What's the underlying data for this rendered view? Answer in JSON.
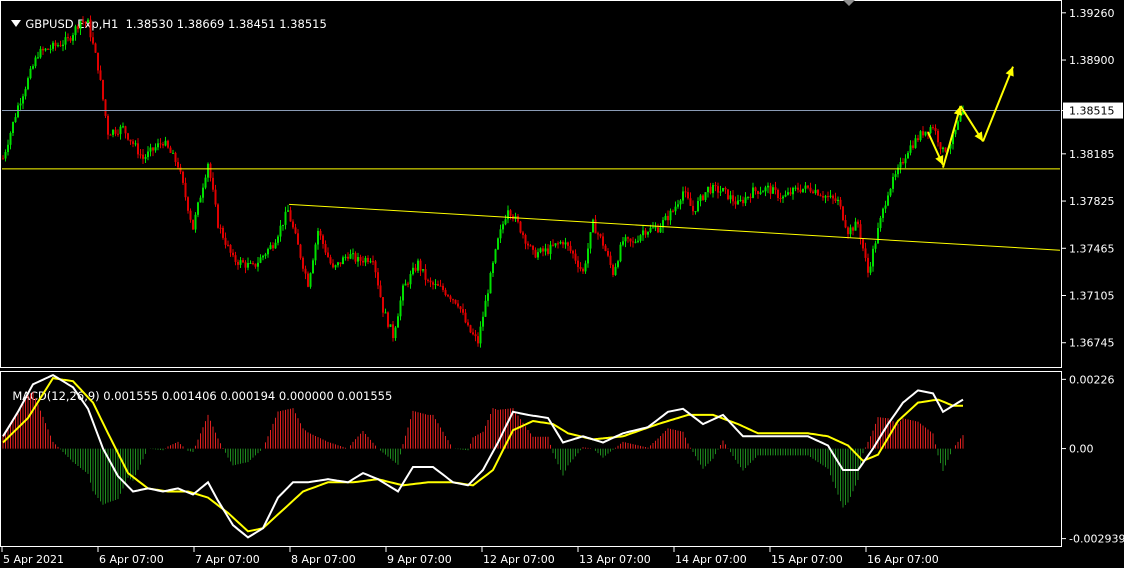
{
  "header": {
    "symbol_line": "GBPUSD.Exp,H1  1.38530 1.38669 1.38451 1.38515",
    "menu_icon": "triangle-down-icon"
  },
  "macd_header": "MACD(12,26,9) 0.001555 0.001406 0.000194 0.000000 0.001555",
  "colors": {
    "background": "#000000",
    "bull": "#00e000",
    "bear": "#e00000",
    "grid_frame": "#ffffff",
    "support_line": "#ffff00",
    "current_price_line": "#8a9bb5",
    "arrows": "#ffff00",
    "macd_line": "#ffffff",
    "signal_line": "#ffff00",
    "hist_pos": "#e02020",
    "hist_neg": "#1e8a1e"
  },
  "chart_data": [
    {
      "type": "candlestick",
      "symbol": "GBPUSD.Exp",
      "timeframe": "H1",
      "ohlc_current": {
        "open": 1.3853,
        "high": 1.38669,
        "low": 1.38451,
        "close": 1.38515
      },
      "ylim": [
        1.3656,
        1.3935
      ],
      "y_ticks": [
        "1.39260",
        "1.38900",
        "1.38515",
        "1.38185",
        "1.37825",
        "1.37465",
        "1.37105",
        "1.36745"
      ],
      "current_price": 1.38515,
      "current_price_label": "1.38515",
      "horizontal_level": 1.3807,
      "trendline": {
        "from": [
          0.2713,
          1.378
        ],
        "to": [
          1.0,
          1.3745
        ]
      },
      "x_ticks": [
        "5 Apr 2021",
        "6 Apr 07:00",
        "7 Apr 07:00",
        "8 Apr 07:00",
        "9 Apr 07:00",
        "12 Apr 07:00",
        "13 Apr 07:00",
        "14 Apr 07:00",
        "15 Apr 07:00",
        "16 Apr 07:00"
      ],
      "path_keypoints": [
        [
          0,
          1.3815
        ],
        [
          6,
          1.3855
        ],
        [
          14,
          1.3895
        ],
        [
          26,
          1.3905
        ],
        [
          31,
          1.392
        ],
        [
          34,
          1.3918
        ],
        [
          38,
          1.3885
        ],
        [
          42,
          1.3835
        ],
        [
          48,
          1.3838
        ],
        [
          56,
          1.3815
        ],
        [
          64,
          1.3828
        ],
        [
          70,
          1.381
        ],
        [
          76,
          1.3762
        ],
        [
          82,
          1.3812
        ],
        [
          86,
          1.3765
        ],
        [
          92,
          1.3738
        ],
        [
          100,
          1.3732
        ],
        [
          108,
          1.375
        ],
        [
          114,
          1.3775
        ],
        [
          118,
          1.3748
        ],
        [
          122,
          1.372
        ],
        [
          126,
          1.376
        ],
        [
          132,
          1.373
        ],
        [
          138,
          1.3742
        ],
        [
          142,
          1.3737
        ],
        [
          148,
          1.374
        ],
        [
          152,
          1.37
        ],
        [
          156,
          1.368
        ],
        [
          160,
          1.3715
        ],
        [
          166,
          1.3735
        ],
        [
          170,
          1.372
        ],
        [
          176,
          1.3715
        ],
        [
          182,
          1.3705
        ],
        [
          186,
          1.3685
        ],
        [
          190,
          1.3675
        ],
        [
          194,
          1.3715
        ],
        [
          198,
          1.3752
        ],
        [
          202,
          1.3778
        ],
        [
          206,
          1.3765
        ],
        [
          212,
          1.3742
        ],
        [
          218,
          1.3745
        ],
        [
          224,
          1.3752
        ],
        [
          228,
          1.3742
        ],
        [
          232,
          1.3728
        ],
        [
          236,
          1.3765
        ],
        [
          240,
          1.375
        ],
        [
          244,
          1.3728
        ],
        [
          248,
          1.3752
        ],
        [
          252,
          1.375
        ],
        [
          256,
          1.376
        ],
        [
          262,
          1.3762
        ],
        [
          268,
          1.3775
        ],
        [
          272,
          1.379
        ],
        [
          276,
          1.3775
        ],
        [
          282,
          1.3792
        ],
        [
          288,
          1.379
        ],
        [
          294,
          1.378
        ],
        [
          300,
          1.379
        ],
        [
          306,
          1.3792
        ],
        [
          312,
          1.3785
        ],
        [
          318,
          1.3792
        ],
        [
          324,
          1.3792
        ],
        [
          330,
          1.3785
        ],
        [
          334,
          1.3782
        ],
        [
          338,
          1.376
        ],
        [
          342,
          1.3765
        ],
        [
          346,
          1.3728
        ],
        [
          350,
          1.376
        ],
        [
          354,
          1.379
        ],
        [
          358,
          1.3805
        ],
        [
          362,
          1.3822
        ],
        [
          368,
          1.3835
        ],
        [
          372,
          1.384
        ],
        [
          376,
          1.382
        ],
        [
          380,
          1.383
        ],
        [
          384,
          1.3852
        ]
      ],
      "annotation_arrows": [
        {
          "from": [
            370,
            1.3835
          ],
          "to": [
            376,
            1.381
          ]
        },
        {
          "from": [
            376,
            1.3808
          ],
          "to": [
            383,
            1.3855
          ]
        },
        {
          "from": [
            383,
            1.3855
          ],
          "to": [
            392,
            1.3828
          ]
        },
        {
          "from": [
            392,
            1.3828
          ],
          "to": [
            404,
            1.3885
          ]
        }
      ]
    },
    {
      "type": "macd",
      "params": "12,26,9",
      "values": {
        "macd": 0.001555,
        "signal": 0.001406,
        "histogram": 0.000194,
        "extra": 0.0,
        "main": 0.001555
      },
      "ylim": [
        -0.00318,
        0.0025
      ],
      "y_ticks": [
        "0.00226",
        "0.00",
        "-0.002939"
      ],
      "macd_keypoints": [
        [
          0,
          0.0004
        ],
        [
          6,
          0.0012
        ],
        [
          12,
          0.0021
        ],
        [
          20,
          0.0024
        ],
        [
          28,
          0.002
        ],
        [
          34,
          0.0013
        ],
        [
          40,
          0.0
        ],
        [
          46,
          -0.0009
        ],
        [
          52,
          -0.0014
        ],
        [
          58,
          -0.0013
        ],
        [
          64,
          -0.0014
        ],
        [
          70,
          -0.0013
        ],
        [
          76,
          -0.0015
        ],
        [
          82,
          -0.0011
        ],
        [
          86,
          -0.0017
        ],
        [
          92,
          -0.0025
        ],
        [
          98,
          -0.0029
        ],
        [
          104,
          -0.0026
        ],
        [
          110,
          -0.0016
        ],
        [
          116,
          -0.0011
        ],
        [
          122,
          -0.0011
        ],
        [
          130,
          -0.001
        ],
        [
          138,
          -0.0011
        ],
        [
          144,
          -0.0008
        ],
        [
          150,
          -0.001
        ],
        [
          158,
          -0.0014
        ],
        [
          164,
          -0.0006
        ],
        [
          172,
          -0.0006
        ],
        [
          180,
          -0.0011
        ],
        [
          186,
          -0.0012
        ],
        [
          192,
          -0.0007
        ],
        [
          198,
          0.0002
        ],
        [
          204,
          0.0012
        ],
        [
          210,
          0.0011
        ],
        [
          218,
          0.001
        ],
        [
          224,
          0.0002
        ],
        [
          232,
          0.0004
        ],
        [
          240,
          0.0002
        ],
        [
          248,
          0.0005
        ],
        [
          258,
          0.0007
        ],
        [
          266,
          0.0012
        ],
        [
          272,
          0.0013
        ],
        [
          280,
          0.0008
        ],
        [
          288,
          0.0011
        ],
        [
          296,
          0.0004
        ],
        [
          304,
          0.0004
        ],
        [
          314,
          0.0004
        ],
        [
          322,
          0.0004
        ],
        [
          330,
          0.0001
        ],
        [
          336,
          -0.0007
        ],
        [
          342,
          -0.0007
        ],
        [
          348,
          0.0
        ],
        [
          354,
          0.0008
        ],
        [
          360,
          0.0015
        ],
        [
          366,
          0.0019
        ],
        [
          372,
          0.0018
        ],
        [
          376,
          0.0012
        ],
        [
          380,
          0.0014
        ],
        [
          384,
          0.0016
        ]
      ],
      "signal_keypoints": [
        [
          0,
          0.0002
        ],
        [
          10,
          0.001
        ],
        [
          20,
          0.0023
        ],
        [
          28,
          0.0022
        ],
        [
          36,
          0.0015
        ],
        [
          42,
          0.0005
        ],
        [
          50,
          -0.0008
        ],
        [
          58,
          -0.0013
        ],
        [
          66,
          -0.0014
        ],
        [
          74,
          -0.0014
        ],
        [
          82,
          -0.0016
        ],
        [
          90,
          -0.0021
        ],
        [
          98,
          -0.0027
        ],
        [
          104,
          -0.0026
        ],
        [
          112,
          -0.002
        ],
        [
          120,
          -0.0014
        ],
        [
          130,
          -0.0011
        ],
        [
          140,
          -0.0011
        ],
        [
          150,
          -0.001
        ],
        [
          160,
          -0.0012
        ],
        [
          170,
          -0.0011
        ],
        [
          180,
          -0.0011
        ],
        [
          188,
          -0.0012
        ],
        [
          196,
          -0.0007
        ],
        [
          204,
          0.0006
        ],
        [
          212,
          0.0009
        ],
        [
          220,
          0.0008
        ],
        [
          226,
          0.0005
        ],
        [
          236,
          0.0003
        ],
        [
          248,
          0.0004
        ],
        [
          262,
          0.0008
        ],
        [
          274,
          0.0011
        ],
        [
          284,
          0.0011
        ],
        [
          294,
          0.0008
        ],
        [
          302,
          0.0005
        ],
        [
          312,
          0.0005
        ],
        [
          322,
          0.0005
        ],
        [
          330,
          0.0004
        ],
        [
          338,
          0.0001
        ],
        [
          344,
          -0.0004
        ],
        [
          350,
          -0.0002
        ],
        [
          358,
          0.0009
        ],
        [
          366,
          0.0015
        ],
        [
          374,
          0.0016
        ],
        [
          380,
          0.0014
        ],
        [
          384,
          0.0014
        ]
      ]
    }
  ]
}
